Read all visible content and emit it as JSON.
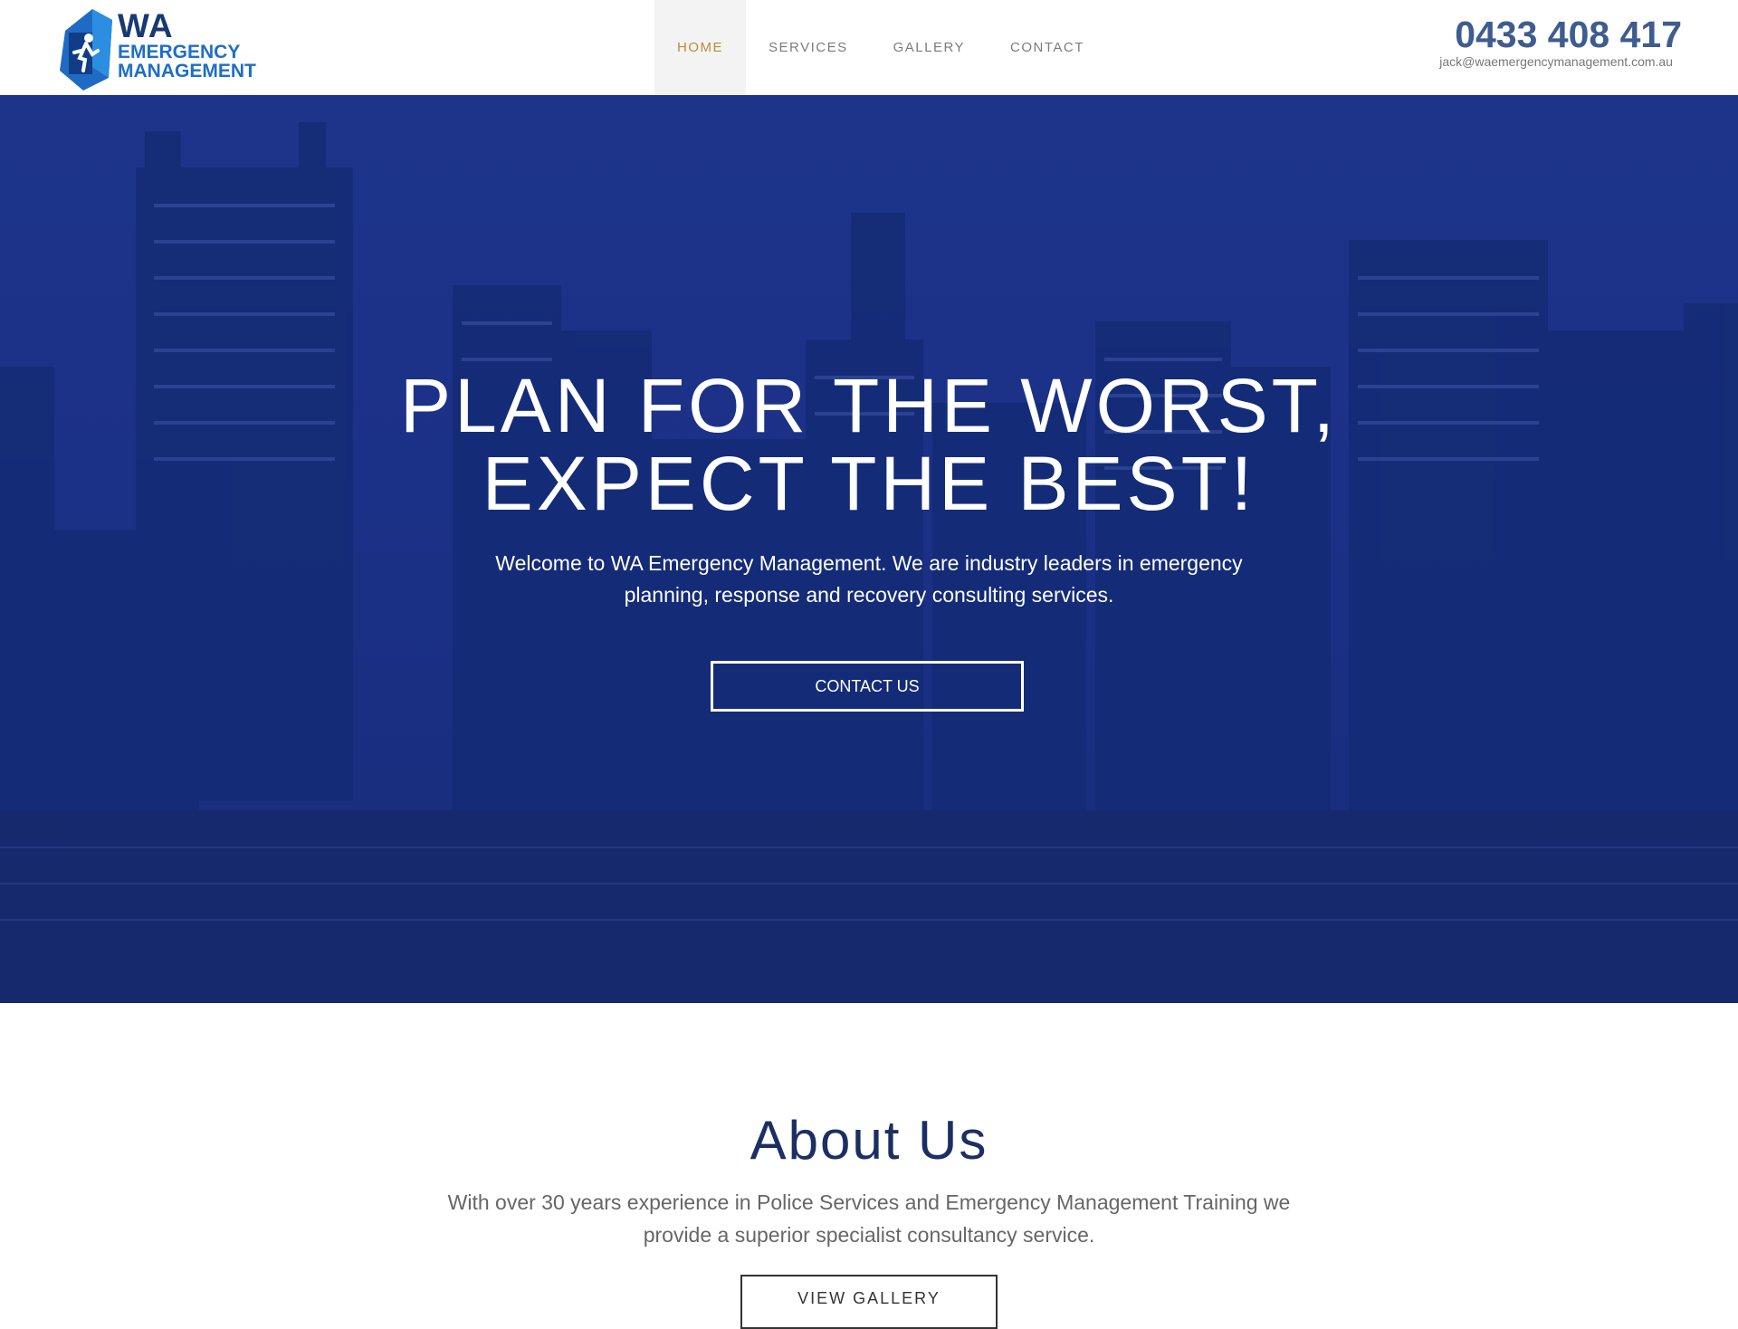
{
  "brand": {
    "line1": "WA",
    "line2": "EMERGENCY",
    "line3": "MANAGEMENT"
  },
  "nav": {
    "items": [
      {
        "label": "HOME",
        "active": true
      },
      {
        "label": "SERVICES",
        "active": false
      },
      {
        "label": "GALLERY",
        "active": false
      },
      {
        "label": "CONTACT",
        "active": false
      }
    ]
  },
  "contact": {
    "phone": "0433 408 417",
    "email": "jack@waemergencymanagement.com.au"
  },
  "hero": {
    "title_line1": "PLAN FOR THE WORST,",
    "title_line2": "EXPECT THE BEST!",
    "subtitle_line1": "Welcome to WA Emergency Management. We are industry leaders in emergency",
    "subtitle_line2": "planning, response and recovery consulting services.",
    "button_label": "CONTACT US"
  },
  "about": {
    "title": "About Us",
    "text_line1": "With over 30 years experience in Police Services and Emergency Management Training we",
    "text_line2": "provide a superior specialist consultancy service.",
    "button_label": "VIEW GALLERY"
  },
  "colors": {
    "accent_active_nav": "#bc8a3e",
    "phone": "#3e5c8f",
    "hero_overlay": "#20378a",
    "about_title": "#1b2f63"
  }
}
